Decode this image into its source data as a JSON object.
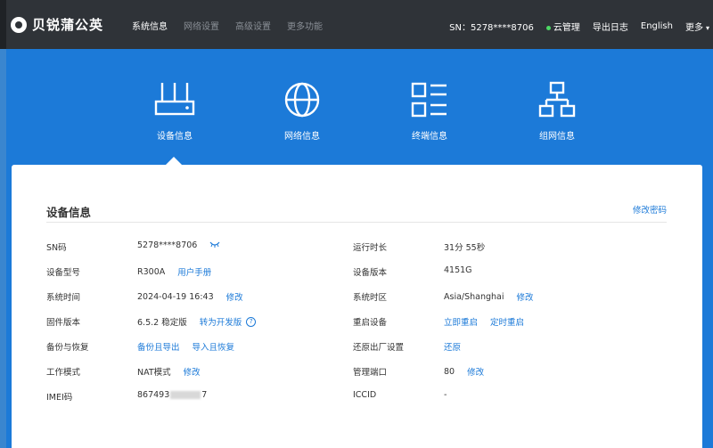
{
  "header": {
    "logo_text": "贝锐蒲公英",
    "nav": [
      {
        "label": "系统信息",
        "active": true
      },
      {
        "label": "网络设置",
        "active": false
      },
      {
        "label": "高级设置",
        "active": false
      },
      {
        "label": "更多功能",
        "active": false
      }
    ],
    "sn_text": "SN：5278****8706",
    "cloud_label": "云管理",
    "export_log": "导出日志",
    "language": "English",
    "more": "更多"
  },
  "tabs": [
    {
      "label": "设备信息",
      "icon": "router-icon"
    },
    {
      "label": "网络信息",
      "icon": "globe-icon"
    },
    {
      "label": "终端信息",
      "icon": "list-icon"
    },
    {
      "label": "组网信息",
      "icon": "network-tree-icon"
    }
  ],
  "panel": {
    "title": "设备信息",
    "change_password": "修改密码",
    "left": {
      "sn": {
        "label": "SN码",
        "value": "5278****8706"
      },
      "model": {
        "label": "设备型号",
        "value": "R300A",
        "link": "用户手册"
      },
      "time": {
        "label": "系统时间",
        "value": "2024-04-19 16:43",
        "link": "修改"
      },
      "firmware": {
        "label": "固件版本",
        "value": "6.5.2 稳定版",
        "link": "转为开发版"
      },
      "backup": {
        "label": "备份与恢复",
        "link1": "备份且导出",
        "link2": "导入且恢复"
      },
      "mode": {
        "label": "工作模式",
        "value": "NAT模式",
        "link": "修改"
      },
      "imei": {
        "label": "IMEI码",
        "value_prefix": "867493",
        "value_suffix": "7"
      }
    },
    "right": {
      "uptime": {
        "label": "运行时长",
        "value": "31分 55秒"
      },
      "dev_version": {
        "label": "设备版本",
        "value": "4151G"
      },
      "timezone": {
        "label": "系统时区",
        "value": "Asia/Shanghai",
        "link": "修改"
      },
      "reboot": {
        "label": "重启设备",
        "link1": "立即重启",
        "link2": "定时重启"
      },
      "factory": {
        "label": "还原出厂设置",
        "link": "还原"
      },
      "mgmt_port": {
        "label": "管理端口",
        "value": "80",
        "link": "修改"
      },
      "iccid": {
        "label": "ICCID",
        "value": "-"
      }
    }
  }
}
